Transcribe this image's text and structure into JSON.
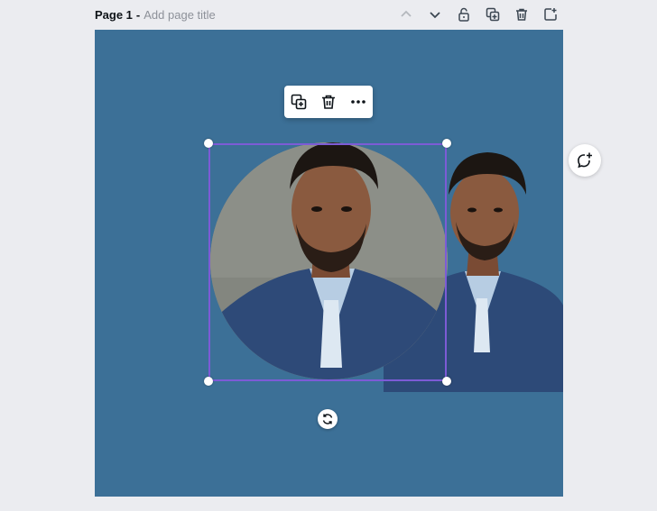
{
  "header": {
    "page_label": "Page 1",
    "separator": "-",
    "title_placeholder": "Add page title"
  },
  "page_tools": [
    {
      "name": "move-page-up",
      "icon": "chevron-up-icon",
      "enabled": false
    },
    {
      "name": "move-page-down",
      "icon": "chevron-down-icon",
      "enabled": true
    },
    {
      "name": "lock-page",
      "icon": "lock-icon",
      "enabled": true
    },
    {
      "name": "duplicate-page",
      "icon": "duplicate-icon",
      "enabled": true
    },
    {
      "name": "delete-page",
      "icon": "trash-icon",
      "enabled": true
    },
    {
      "name": "add-page",
      "icon": "add-page-icon",
      "enabled": true
    }
  ],
  "canvas": {
    "background_color": "#3c7097",
    "selection_color": "#7d5bd6"
  },
  "element_toolbar": {
    "buttons": [
      {
        "name": "duplicate",
        "icon": "duplicate-icon"
      },
      {
        "name": "delete",
        "icon": "trash-icon"
      },
      {
        "name": "more",
        "icon": "more-dots-icon"
      }
    ]
  },
  "comment_button": {
    "icon": "add-comment-icon"
  },
  "rotate_handle": {
    "icon": "rotate-icon"
  }
}
